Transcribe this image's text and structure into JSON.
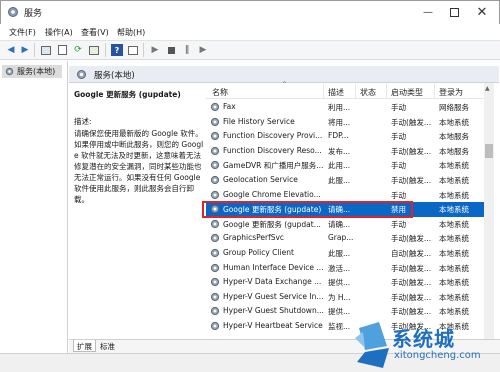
{
  "window": {
    "title": "服务"
  },
  "menu": [
    "文件(F)",
    "操作(A)",
    "查看(V)",
    "帮助(H)"
  ],
  "tree": {
    "label": "服务(本地)"
  },
  "main": {
    "title": "服务(本地)"
  },
  "description": {
    "title": "Google 更新服务 (gupdate)",
    "label": "描述:",
    "text": "请确保您使用最新版的 Google 软件。如果停用或中断此服务，则您的 Google 软件就无法及时更新，这意味着无法修复潜在的安全漏洞，同时某些功能也无法正常运行。如果没有任何 Google 软件使用此服务，则此服务会自行卸载。"
  },
  "table": {
    "columns": [
      "名称",
      "描述",
      "状态",
      "启动类型",
      "登录为"
    ],
    "rows": [
      [
        "Fax",
        "利用...",
        "",
        "手动",
        "网络服务"
      ],
      [
        "File History Service",
        "将用...",
        "",
        "手动(触发...",
        "本地系统"
      ],
      [
        "Function Discovery Provi...",
        "FDP...",
        "",
        "手动",
        "本地服务"
      ],
      [
        "Function Discovery Reso...",
        "发布...",
        "",
        "手动(触发...",
        "本地服务"
      ],
      [
        "GameDVR 和广播用户服务...",
        "此用...",
        "",
        "手动",
        "本地系统"
      ],
      [
        "Geolocation Service",
        "此服...",
        "",
        "手动(触发...",
        "本地系统"
      ],
      [
        "Google Chrome Elevatio...",
        "",
        "",
        "手动",
        "本地系统"
      ],
      [
        "Google 更新服务 (gupdate)",
        "请确...",
        "",
        "禁用",
        "本地系统"
      ],
      [
        "Google 更新服务 (gupdat...",
        "请确...",
        "",
        "手动",
        "本地系统"
      ],
      [
        "GraphicsPerfSvc",
        "Grap...",
        "",
        "手动(触发...",
        "本地系统"
      ],
      [
        "Group Policy Client",
        "此服...",
        "",
        "自动(触发...",
        "本地系统"
      ],
      [
        "Human Interface Device ...",
        "激活...",
        "",
        "手动(触发...",
        "本地系统"
      ],
      [
        "Hyper-V Data Exchange ...",
        "提供...",
        "",
        "手动(触发...",
        "本地系统"
      ],
      [
        "Hyper-V Guest Service In...",
        "为 H...",
        "",
        "手动(触发...",
        "本地系统"
      ],
      [
        "Hyper-V Guest Shutdown...",
        "提供...",
        "",
        "手动(触发...",
        "本地系统"
      ],
      [
        "Hyper-V Heartbeat Service",
        "监视...",
        "",
        "手动(触发...",
        "本地系统"
      ]
    ],
    "selected_index": 7
  },
  "tabs": [
    "扩展",
    "标准"
  ],
  "watermark": {
    "text": "系统城",
    "url": "xitongcheng.com"
  },
  "colors": {
    "accent": "#0a67c6",
    "highlight": "#d9262b",
    "watermark": "#1f6fc0"
  }
}
